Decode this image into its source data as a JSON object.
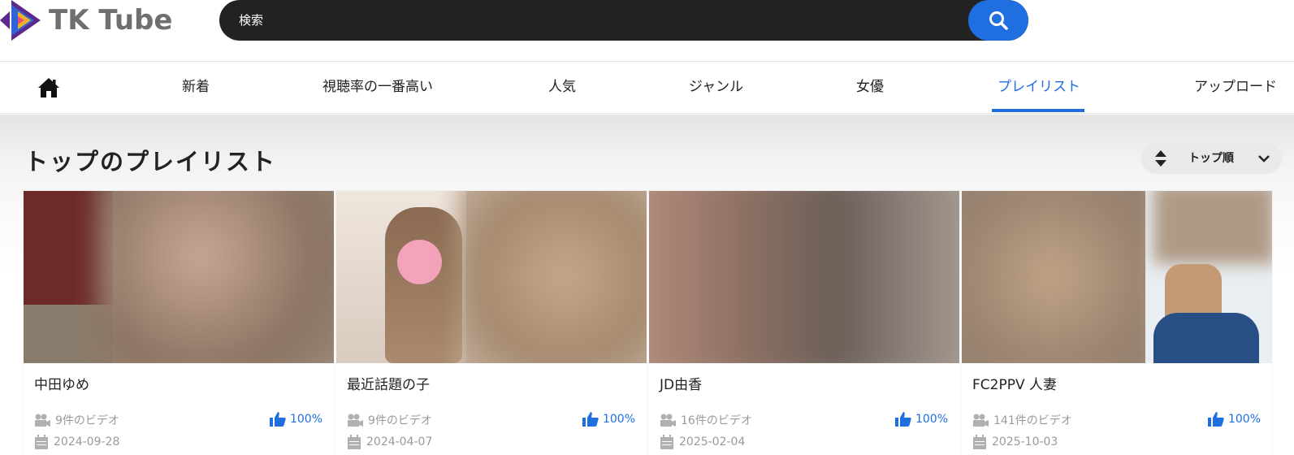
{
  "header": {
    "logo_text": "TK Tube",
    "search_placeholder": "検索"
  },
  "nav": {
    "items": [
      {
        "label": "新着"
      },
      {
        "label": "視聴率の一番高い"
      },
      {
        "label": "人気"
      },
      {
        "label": "ジャンル"
      },
      {
        "label": "女優"
      },
      {
        "label": "プレイリスト",
        "active": true
      },
      {
        "label": "アップロード"
      }
    ]
  },
  "section": {
    "title": "トップのプレイリスト",
    "sort_label": "トップ順"
  },
  "playlists": [
    {
      "title": "中田ゆめ",
      "video_count": "9件のビデオ",
      "likes": "100%",
      "date": "2024-09-28"
    },
    {
      "title": "最近話題の子",
      "video_count": "9件のビデオ",
      "likes": "100%",
      "date": "2024-04-07"
    },
    {
      "title": "JD由香",
      "video_count": "16件のビデオ",
      "likes": "100%",
      "date": "2025-02-04"
    },
    {
      "title": "FC2PPV 人妻",
      "video_count": "141件のビデオ",
      "likes": "100%",
      "date": "2025-10-03"
    }
  ],
  "colors": {
    "accent": "#1f6fe0",
    "search_bg": "#222222",
    "logo_text": "#6f6f6f"
  }
}
